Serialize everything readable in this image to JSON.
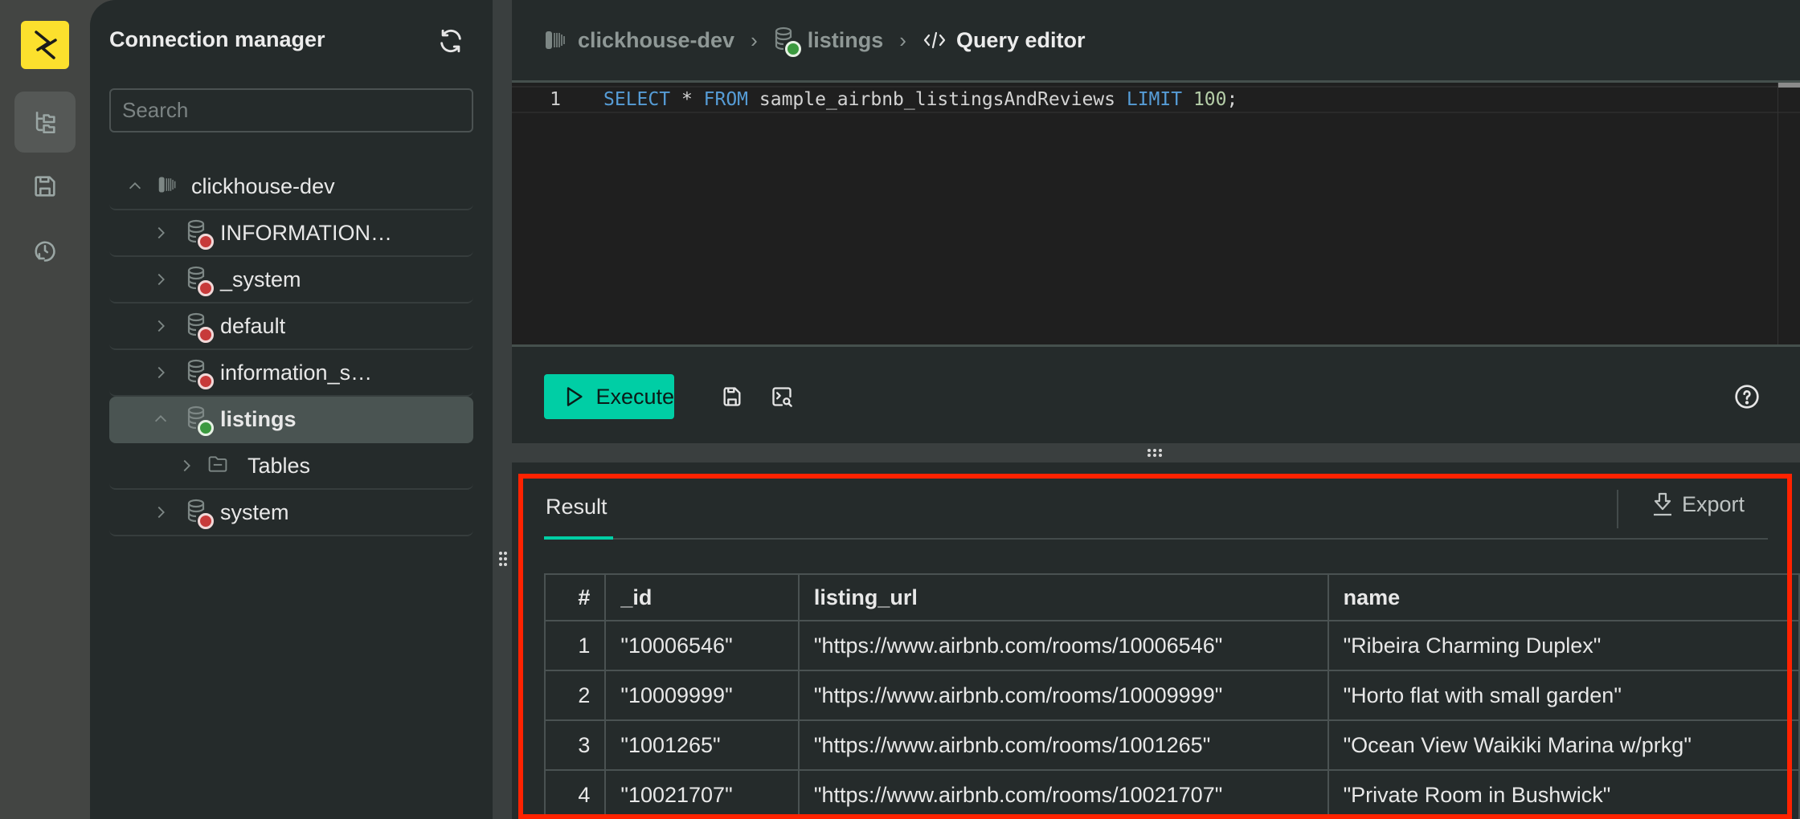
{
  "app": {
    "rail": {
      "logo": "logo-icon",
      "items": [
        {
          "name": "connections",
          "icon": "tree-folders-icon",
          "active": true
        },
        {
          "name": "saved-queries",
          "icon": "save-icon",
          "active": false
        },
        {
          "name": "history",
          "icon": "history-icon",
          "active": false
        }
      ]
    }
  },
  "sidebar": {
    "title": "Connection manager",
    "refresh_icon": "refresh-icon",
    "search_placeholder": "Search",
    "search_value": "",
    "tree": [
      {
        "label": "clickhouse-dev",
        "level": 0,
        "expanded": true,
        "icon": "clickhouse-icon",
        "status": null
      },
      {
        "label": "INFORMATION…",
        "level": 1,
        "expanded": false,
        "icon": "database-icon",
        "status": "disconnected"
      },
      {
        "label": "_system",
        "level": 1,
        "expanded": false,
        "icon": "database-icon",
        "status": "disconnected"
      },
      {
        "label": "default",
        "level": 1,
        "expanded": false,
        "icon": "database-icon",
        "status": "disconnected"
      },
      {
        "label": "information_s…",
        "level": 1,
        "expanded": false,
        "icon": "database-icon",
        "status": "disconnected"
      },
      {
        "label": "listings",
        "level": 1,
        "expanded": true,
        "icon": "database-icon",
        "status": "connected",
        "selected": true
      },
      {
        "label": "Tables",
        "level": 2,
        "expanded": false,
        "icon": "folder-icon",
        "status": null
      },
      {
        "label": "system",
        "level": 1,
        "expanded": false,
        "icon": "database-icon",
        "status": "disconnected"
      }
    ]
  },
  "breadcrumb": {
    "items": [
      {
        "label": "clickhouse-dev",
        "icon": "clickhouse-icon"
      },
      {
        "label": "listings",
        "icon": "database-icon"
      },
      {
        "label": "Query editor",
        "icon": "code-icon"
      }
    ]
  },
  "editor": {
    "line_number": "1",
    "tokens": [
      {
        "t": "SELECT",
        "c": "kw"
      },
      {
        "t": " * ",
        "c": "plain"
      },
      {
        "t": "FROM",
        "c": "kw"
      },
      {
        "t": " sample_airbnb_listingsAndReviews ",
        "c": "plain"
      },
      {
        "t": "LIMIT",
        "c": "kw"
      },
      {
        "t": " ",
        "c": "plain"
      },
      {
        "t": "100",
        "c": "num"
      },
      {
        "t": ";",
        "c": "plain"
      }
    ]
  },
  "toolbar": {
    "execute_label": "Execute",
    "save_icon": "save-icon",
    "explain_icon": "explain-query-icon",
    "help_icon": "help-icon"
  },
  "results": {
    "tab_label": "Result",
    "export_label": "Export",
    "columns": [
      "#",
      "_id",
      "listing_url",
      "name"
    ],
    "rows": [
      [
        "1",
        "\"10006546\"",
        "\"https://www.airbnb.com/rooms/10006546\"",
        "\"Ribeira Charming Duplex\""
      ],
      [
        "2",
        "\"10009999\"",
        "\"https://www.airbnb.com/rooms/10009999\"",
        "\"Horto flat with small garden\""
      ],
      [
        "3",
        "\"1001265\"",
        "\"https://www.airbnb.com/rooms/1001265\"",
        "\"Ocean View Waikiki Marina w/prkg\""
      ],
      [
        "4",
        "\"10021707\"",
        "\"https://www.airbnb.com/rooms/10021707\"",
        "\"Private Room in Bushwick\""
      ]
    ]
  },
  "colors": {
    "accent": "#00cea5",
    "logo_bg": "#fce02d",
    "status_connected": "#3b9a3f",
    "status_disconnected": "#c73a3a",
    "annotation_box": "#ff2200"
  }
}
